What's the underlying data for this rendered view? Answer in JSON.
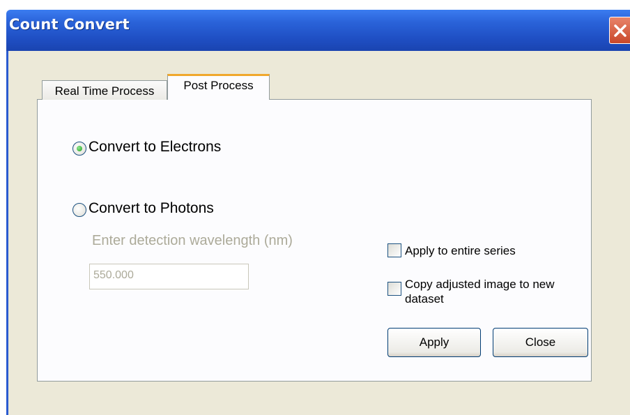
{
  "window": {
    "title": "Count Convert"
  },
  "tabs": [
    {
      "label": "Real Time Process",
      "active": false
    },
    {
      "label": "Post Process",
      "active": true
    }
  ],
  "options": {
    "convert_electrons": {
      "label": "Convert to Electrons",
      "selected": true
    },
    "convert_photons": {
      "label": "Convert to Photons",
      "selected": false
    }
  },
  "wavelength": {
    "label": "Enter detection wavelength (nm)",
    "value": "550.000"
  },
  "checkboxes": {
    "apply_series": {
      "label": "Apply to entire series",
      "checked": false
    },
    "copy_image": {
      "label_line1": "Copy adjusted image to new",
      "label_line2": "dataset",
      "checked": false
    }
  },
  "buttons": {
    "apply": "Apply",
    "close": "Close"
  },
  "colors": {
    "titlebar": "#2a63d9",
    "active_tab_accent": "#f0a82d",
    "client_bg": "#ece9d8"
  }
}
